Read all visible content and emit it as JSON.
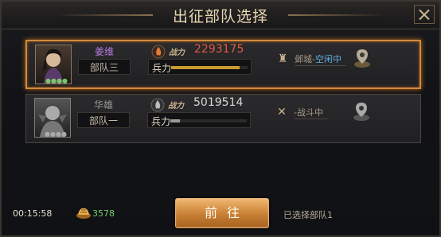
{
  "window": {
    "title": "出征部队选择"
  },
  "cards": [
    {
      "hero_name": "姜维",
      "hero_color": "#b47ae0",
      "troop": "部队三",
      "power_label": "战力",
      "power": "2293175",
      "power_color": "#e05a45",
      "soldiers_label": "兵力",
      "soldiers_level": 0.9,
      "bar_color": "#c99a2e",
      "status": "邺城-",
      "status_highlight": "空闲中",
      "status_highlight_color": "#5fb0e6",
      "selected": true
    },
    {
      "hero_name": "华雄",
      "hero_color": "#9a9a9a",
      "troop": "部队一",
      "power_label": "战力",
      "power": "5019514",
      "power_color": "#d8d8d8",
      "soldiers_label": "兵力",
      "soldiers_level": 0.12,
      "bar_color": "#9a9a9a",
      "status": "-战斗中",
      "status_highlight": "",
      "status_highlight_color": "#5fb0e6",
      "selected": false
    }
  ],
  "footer": {
    "timer": "00:15:58",
    "food": "3578",
    "go_label": "前往",
    "selected_text": "已选择部队1"
  }
}
